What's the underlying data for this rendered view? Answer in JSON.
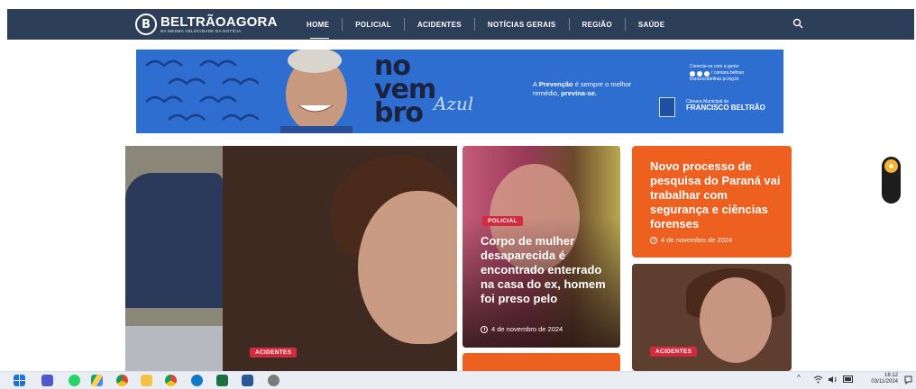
{
  "header": {
    "logo_mark": "B",
    "logo_name": "BELTRÃOAGORA",
    "logo_tagline": "NA MESMA VELOCIDADE DA NOTÍCIA",
    "menu": [
      {
        "label": "HOME",
        "active": true
      },
      {
        "label": "POLICIAL",
        "active": false
      },
      {
        "label": "ACIDENTES",
        "active": false
      },
      {
        "label": "NOTÍCIAS GERAIS",
        "active": false
      },
      {
        "label": "REGIÃO",
        "active": false
      },
      {
        "label": "SAÚDE",
        "active": false
      }
    ],
    "search_icon": "search-icon",
    "bg_color": "#2c3e58"
  },
  "banner": {
    "line1": "no",
    "line2": "vem",
    "line3": "bro",
    "script": "Azul",
    "message_prefix": "A ",
    "message_bold1": "Prevenção",
    "message_mid": " é sempre o melhor remédio, ",
    "message_bold2": "previna-se.",
    "social_title": "Conecte-se com a gente",
    "social_handle": "/ camara.beltrao",
    "social_site": "franciscobeltrao.pr.leg.br",
    "chamber_small": "Câmara Municipal de",
    "chamber_name": "FRANCISCO BELTRÃO",
    "bg_color": "#2d6ed0"
  },
  "cards": {
    "main": {
      "badge": "ACIDENTES"
    },
    "policial": {
      "badge": "POLICIAL",
      "headline": "Corpo de mulher desaparecida é encontrado enterrado na casa do ex, homem foi preso pelo",
      "date": "4 de novembro de 2024"
    },
    "orange": {
      "headline": "Novo processo de pesquisa do Paraná vai trabalhar com segurança e ciências forenses",
      "date": "4 de novembro de 2024",
      "bg_color": "#ee6020"
    },
    "small": {
      "badge": "ACIDENTES"
    }
  },
  "theme_toggle": {
    "icon": "sun-icon"
  },
  "taskbar": {
    "time": "16:12",
    "date": "03/11/2024",
    "icons": [
      "windows-start-icon",
      "teams-icon",
      "whatsapp-icon",
      "google-drive-icon",
      "chrome-icon",
      "file-explorer-icon",
      "google-chrome-alt-icon",
      "edge-icon",
      "excel-icon",
      "word-icon",
      "settings-icon"
    ]
  }
}
